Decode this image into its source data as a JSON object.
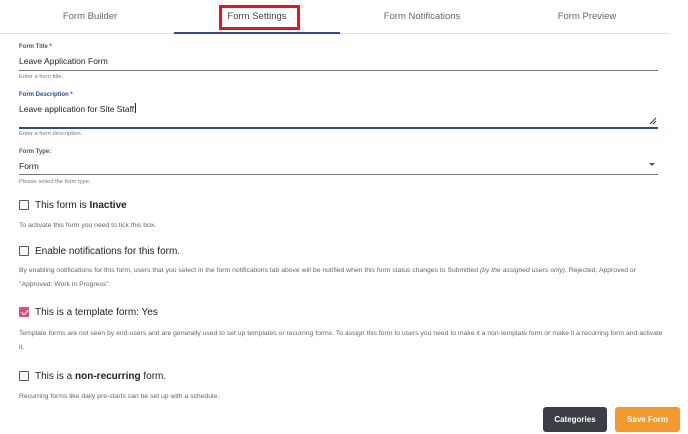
{
  "tabs": [
    {
      "label": "Form Builder"
    },
    {
      "label": "Form Settings"
    },
    {
      "label": "Form Notifications"
    },
    {
      "label": "Form Preview"
    }
  ],
  "form_title": {
    "label": "Form Title *",
    "value": "Leave Application Form",
    "helper": "Enter a form title."
  },
  "form_description": {
    "label": "Form Description *",
    "value": "Leave application for Site Staff",
    "helper": "Enter a form description."
  },
  "form_type": {
    "label": "Form Type:",
    "value": "Form",
    "helper": "Please select the form type."
  },
  "inactive": {
    "checked": false,
    "label_prefix": "This form is ",
    "label_bold": "Inactive",
    "description": "To activate this form you need to tick this box."
  },
  "notifications": {
    "checked": false,
    "label": "Enable notifications for this form.",
    "description_a": "By enabling notifications for this form, users that you select in the form notifications tab above will be notified when this form status changes to Submitted ",
    "description_italic": "(by the assigned users only)",
    "description_b": ", Rejected, Approved or \"Approved: Work in Progress\"."
  },
  "template": {
    "checked": true,
    "label": "This is a template form: Yes",
    "description": "Template forms are not seen by end-users and are generally used to set up templates or recurring forms. To assign this form to users you need to make it a non-template form or make it a recurring form and activate it."
  },
  "recurring": {
    "checked": false,
    "label_prefix": "This is a ",
    "label_bold": "non-recurring",
    "label_suffix": " form.",
    "description": "Recurring forms like daily pre-starts can be set up with a schedule."
  },
  "buttons": {
    "categories": "Categories",
    "save": "Save Form"
  },
  "colors": {
    "accent": "#2c4a9b",
    "checkbox_checked": "#e24d7a",
    "save_button": "#f39a2d",
    "categories_button": "#3b3e44",
    "highlight": "#e8141c"
  }
}
